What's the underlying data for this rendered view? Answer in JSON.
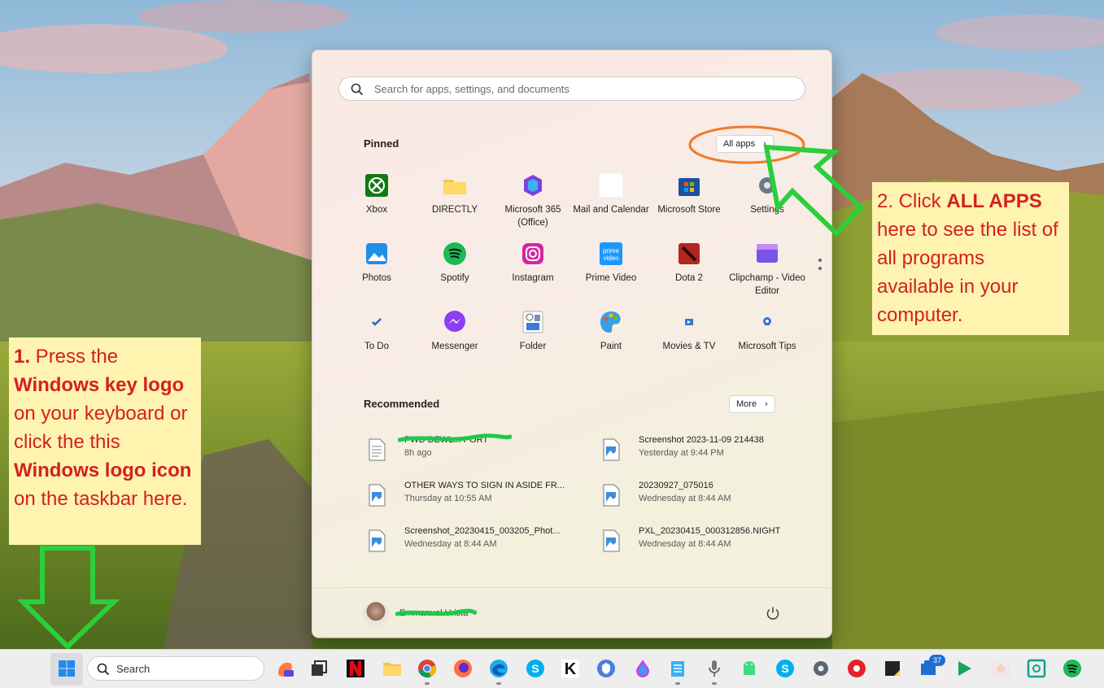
{
  "start_menu": {
    "search_placeholder": "Search for apps, settings, and documents",
    "pinned_title": "Pinned",
    "all_apps_label": "All apps",
    "pinned_apps": [
      {
        "label": "Xbox",
        "icon": "xbox-icon"
      },
      {
        "label": "DIRECTLY",
        "icon": "folder-icon"
      },
      {
        "label": "Microsoft 365 (Office)",
        "icon": "microsoft-365-icon"
      },
      {
        "label": "Mail and Calendar",
        "icon": "mail-icon"
      },
      {
        "label": "Microsoft Store",
        "icon": "store-icon"
      },
      {
        "label": "Settings",
        "icon": "settings-icon"
      },
      {
        "label": "Photos",
        "icon": "photos-icon"
      },
      {
        "label": "Spotify",
        "icon": "spotify-icon"
      },
      {
        "label": "Instagram",
        "icon": "instagram-icon"
      },
      {
        "label": "Prime Video",
        "icon": "prime-video-icon"
      },
      {
        "label": "Dota 2",
        "icon": "dota-icon"
      },
      {
        "label": "Clipchamp - Video Editor",
        "icon": "clipchamp-icon"
      },
      {
        "label": "To Do",
        "icon": "todo-icon"
      },
      {
        "label": "Messenger",
        "icon": "messenger-icon"
      },
      {
        "label": "Folder",
        "icon": "folder-app-icon"
      },
      {
        "label": "Paint",
        "icon": "paint-icon"
      },
      {
        "label": "Movies & TV",
        "icon": "movies-icon"
      },
      {
        "label": "Microsoft Tips",
        "icon": "tips-icon"
      }
    ],
    "recommended_title": "Recommended",
    "more_label": "More",
    "recommended": [
      {
        "name": "PWD DEWL... PORT",
        "time": "8h ago",
        "icon": "document-icon"
      },
      {
        "name": "Screenshot 2023-11-09 214438",
        "time": "Yesterday at 9:44 PM",
        "icon": "image-file-icon"
      },
      {
        "name": "OTHER WAYS TO SIGN IN ASIDE FR...",
        "time": "Thursday at 10:55 AM",
        "icon": "image-file-icon"
      },
      {
        "name": "20230927_075016",
        "time": "Wednesday at 8:44 AM",
        "icon": "image-file-icon"
      },
      {
        "name": "Screenshot_20230415_003205_Phot...",
        "time": "Wednesday at 8:44 AM",
        "icon": "image-file-icon"
      },
      {
        "name": "PXL_20230415_000312856.NIGHT",
        "time": "Wednesday at 8:44 AM",
        "icon": "image-file-icon"
      }
    ],
    "user_name": "Emmanuel Urista",
    "power_icon": "power-icon"
  },
  "annotations": {
    "step1": {
      "num": "1.",
      "t1": " Press the ",
      "b1": "Windows key logo",
      "t2": " on your keyboard or click the this ",
      "b2": "Windows logo icon",
      "t3": " on the taskbar here."
    },
    "step2": {
      "t1": "2. Click ",
      "b1": "ALL APPS",
      "t2": " here to see the list of all programs available in your computer."
    }
  },
  "taskbar": {
    "search_label": "Search",
    "badge_count": "37",
    "icons": [
      "windows-start-icon",
      "copilot-icon",
      "task-view-icon",
      "netflix-icon",
      "file-explorer-icon",
      "chrome-icon",
      "firefox-icon",
      "edge-icon",
      "skype-icon",
      "k-app-icon",
      "shield-app-icon",
      "drop-app-icon",
      "notepad-icon",
      "mic-icon",
      "android-icon",
      "skype-icon",
      "settings-icon",
      "record-icon",
      "sticky-notes-icon",
      "store-badge-icon",
      "play-games-icon",
      "anime-app-icon",
      "kaspersky-icon",
      "spotify-icon"
    ]
  },
  "colors": {
    "annotation_bg": "#fff3b0",
    "annotation_text": "#d42020",
    "arrow": "#2ad03a",
    "circle": "#f07a2a"
  }
}
